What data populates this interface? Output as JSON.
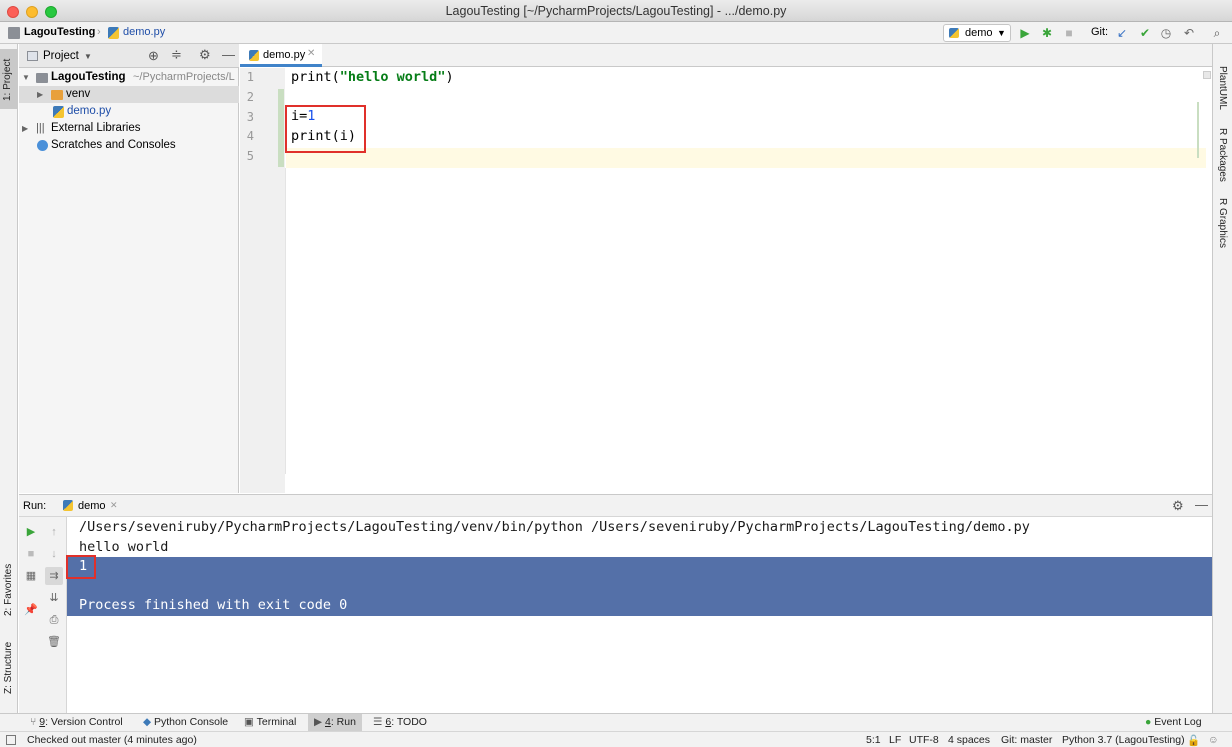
{
  "window": {
    "title": "LagouTesting [~/PycharmProjects/LagouTesting] - .../demo.py"
  },
  "navbar": {
    "crumb_project": "LagouTesting",
    "crumb_file": "demo.py",
    "run_config": "demo",
    "git_label": "Git:"
  },
  "left_stripe": {
    "project": "1: Project",
    "favorites": "2: Favorites",
    "structure": "Z: Structure"
  },
  "right_stripe": {
    "plantuml": "PlantUML",
    "r_packages": "R Packages",
    "r_graphics": "R Graphics"
  },
  "project_panel": {
    "header": "Project",
    "tree": [
      {
        "label": "LagouTesting",
        "path": "~/PycharmProjects/L",
        "icon": "folder-icon",
        "arrow": "▼"
      },
      {
        "label": "venv",
        "icon": "folder-icon",
        "arrow": "▶"
      },
      {
        "label": "demo.py",
        "icon": "python-file-icon",
        "arrow": ""
      },
      {
        "label": "External Libraries",
        "icon": "library-icon",
        "arrow": "▶"
      },
      {
        "label": "Scratches and Consoles",
        "icon": "scratch-icon",
        "arrow": ""
      }
    ]
  },
  "editor": {
    "tab": "demo.py",
    "line_numbers": [
      "1",
      "2",
      "3",
      "4",
      "5"
    ],
    "lines": {
      "l1_fn": "print(",
      "l1_str": "\"hello world\"",
      "l1_end": ")",
      "l3_var": "i=",
      "l3_num": "1",
      "l4": "print(i)"
    }
  },
  "run_panel": {
    "label": "Run:",
    "tab": "demo",
    "output": [
      "/Users/seveniruby/PycharmProjects/LagouTesting/venv/bin/python /Users/seveniruby/PycharmProjects/LagouTesting/demo.py",
      "hello world",
      "1",
      "",
      "Process finished with exit code 0"
    ]
  },
  "tool_windows": {
    "version_control_num": "9",
    "version_control": ": Version Control",
    "python_console": "Python Console",
    "terminal": "Terminal",
    "run_num": "4",
    "run": ": Run",
    "todo_num": "6",
    "todo": ": TODO",
    "event_log": "Event Log"
  },
  "status_bar": {
    "message": "Checked out master (4 minutes ago)",
    "position": "5:1",
    "line_sep": "LF",
    "encoding": "UTF-8",
    "indent": "4 spaces",
    "git": "Git: master",
    "interpreter": "Python 3.7 (LagouTesting)"
  },
  "colors": {
    "selection": "#5470a8",
    "string": "#067d17",
    "number": "#1750eb",
    "annotation_box": "#e0302a"
  }
}
